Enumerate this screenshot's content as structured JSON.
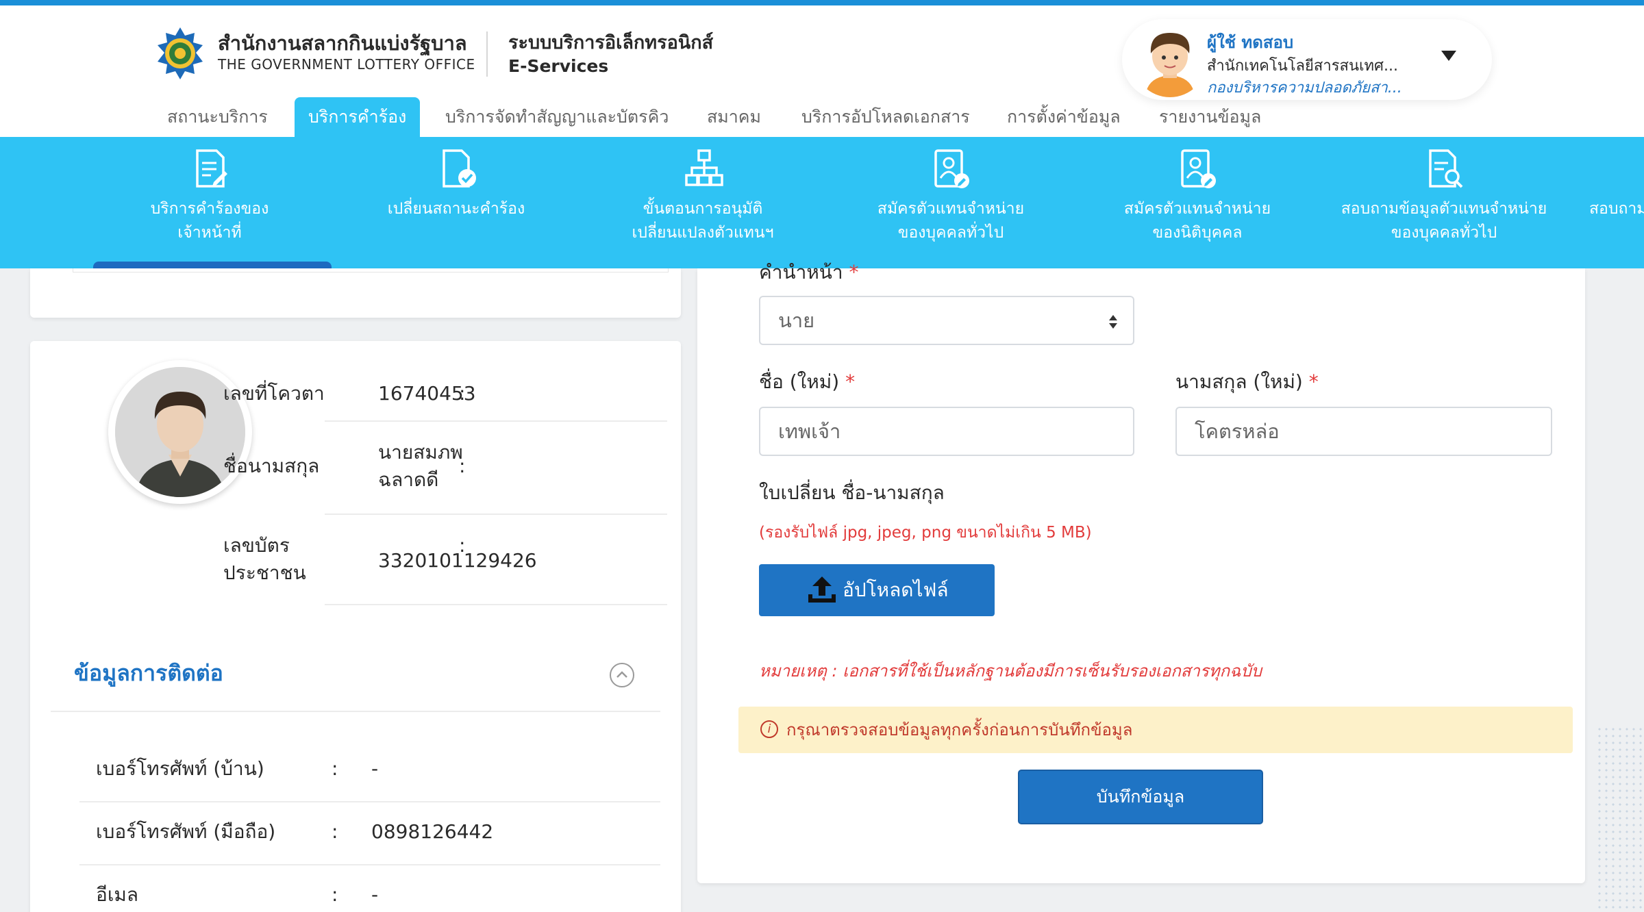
{
  "header": {
    "org_name_th": "สำนักงานสลากกินแบ่งรัฐบาล",
    "org_name_en": "THE GOVERNMENT LOTTERY OFFICE",
    "system_name_th": "ระบบบริการอิเล็กทรอนิกส์",
    "system_name_en": "E-Services"
  },
  "user": {
    "name": "ผู้ใช้ ทดสอบ",
    "department": "สำนักเทคโนโลยีสารสนเทศ...",
    "division": "กองบริหารความปลอดภัยสา..."
  },
  "main_tabs": [
    {
      "label": "สถานะบริการ",
      "active": false
    },
    {
      "label": "บริการคำร้อง",
      "active": true
    },
    {
      "label": "บริการจัดทำสัญญาและบัตรคิว",
      "active": false
    },
    {
      "label": "สมาคม",
      "active": false
    },
    {
      "label": "บริการอัปโหลดเอกสาร",
      "active": false
    },
    {
      "label": "การตั้งค่าข้อมูล",
      "active": false
    },
    {
      "label": "รายงานข้อมูล",
      "active": false
    }
  ],
  "sub_nav": [
    {
      "line1": "บริการคำร้องของ",
      "line2": "เจ้าหน้าที่",
      "icon": "edit-document-icon"
    },
    {
      "line1": "เปลี่ยนสถานะคำร้อง",
      "line2": "",
      "icon": "document-check-icon"
    },
    {
      "line1": "ขั้นตอนการอนุมัติ",
      "line2": "เปลี่ยนแปลงตัวแทนฯ",
      "icon": "workflow-icon"
    },
    {
      "line1": "สมัครตัวแทนจำหน่าย",
      "line2": "ของบุคคลทั่วไป",
      "icon": "person-card-edit-icon"
    },
    {
      "line1": "สมัครตัวแทนจำหน่าย",
      "line2": "ของนิติบุคคล",
      "icon": "company-card-edit-icon"
    },
    {
      "line1": "สอบถามข้อมูลตัวแทนจำหน่าย",
      "line2": "ของบุคคลทั่วไป",
      "icon": "document-search-icon"
    },
    {
      "line1": "สอบถาม",
      "line2": "",
      "icon": ""
    }
  ],
  "profile": {
    "quota_label": "เลขที่โควตา",
    "quota_value": "16740453",
    "name_label": "ชื่อนามสกุล",
    "name_value_line1": "นายสมภพ",
    "name_value_line2": "ฉลาดดี",
    "id_label_line1": "เลขบัตร",
    "id_label_line2": "ประชาชน",
    "id_value": "3320101129426",
    "colon": ":"
  },
  "contact": {
    "title": "ข้อมูลการติดต่อ",
    "rows": [
      {
        "label": "เบอร์โทรศัพท์ (บ้าน)",
        "value": "-"
      },
      {
        "label": "เบอร์โทรศัพท์ (มือถือ)",
        "value": "0898126442"
      },
      {
        "label": "อีเมล",
        "value": "-"
      }
    ]
  },
  "form": {
    "title_prefix_label": "คำนำหน้า",
    "title_prefix_value": "นาย",
    "first_name_label": "ชื่อ (ใหม่)",
    "first_name_value": "เทพเจ้า",
    "last_name_label": "นามสกุล (ใหม่)",
    "last_name_value": "โคตรหล่อ",
    "required_mark": "*",
    "doc_label": "ใบเปลี่ยน ชื่อ-นามสกุล",
    "file_hint": "(รองรับไฟล์ jpg, jpeg, png ขนาดไม่เกิน 5 MB)",
    "upload_label": "อัปโหลดไฟล์",
    "note": "หมายเหตุ : เอกสารที่ใช้เป็นหลักฐานต้องมีการเซ็นรับรองเอกสารทุกฉบับ",
    "warning": "กรุณาตรวจสอบข้อมูลทุกครั้งก่อนการบันทึกข้อมูล",
    "warning_icon_glyph": "i",
    "save_label": "บันทึกข้อมูล"
  },
  "colors": {
    "accent": "#2fc3f4",
    "primary": "#1f74c4",
    "danger": "#e23b3b",
    "warning_bg": "#fdf1c9"
  }
}
